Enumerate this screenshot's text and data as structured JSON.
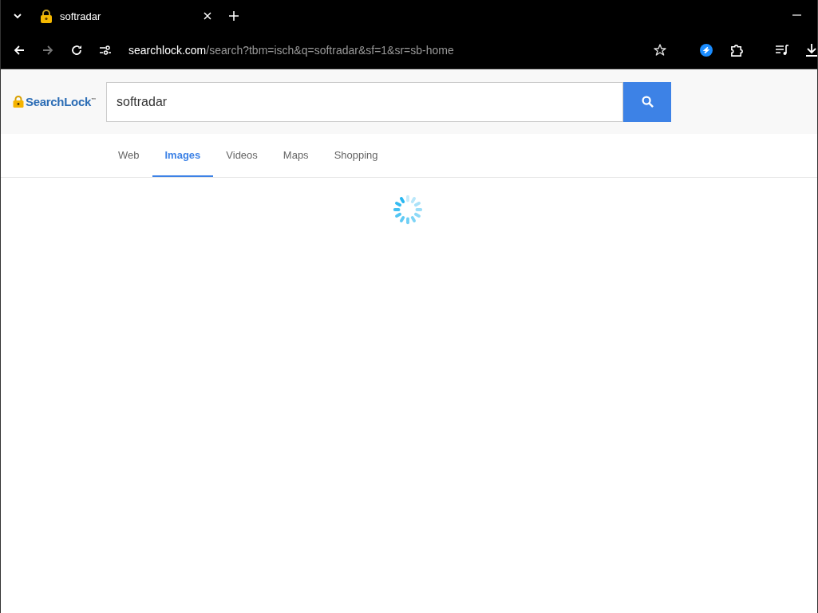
{
  "browser": {
    "tab_title": "softradar",
    "address": {
      "host": "searchlock.com",
      "path": "/search?tbm=isch&q=softradar&sf=1&sr=sb-home"
    }
  },
  "page": {
    "logo": "SearchLock$^{™}$",
    "search": {
      "value": "softradar"
    },
    "tabs": [
      {
        "label": "Web",
        "selected": false
      },
      {
        "label": "Images",
        "selected": true
      },
      {
        "label": "Videos",
        "selected": false
      },
      {
        "label": "Maps",
        "selected": false
      },
      {
        "label": "Shopping",
        "selected": false
      }
    ],
    "loading": true
  }
}
